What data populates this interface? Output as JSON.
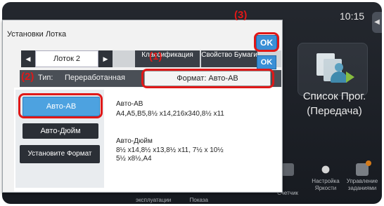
{
  "status": {
    "clock": "10:15"
  },
  "home": {
    "program_tile_line1": "Список Прог.",
    "program_tile_line2": "(Передача)",
    "bottom_items": [
      {
        "label": "Счетчик"
      },
      {
        "label": "Настройка Яркости"
      },
      {
        "label": "Управление заданиями"
      }
    ],
    "bottom_line2": [
      "эксплуатации",
      "Показа"
    ]
  },
  "dialog": {
    "title": "Установки Лотка",
    "ok_label": "OK",
    "tray_tab": "Лоток 2",
    "classification_tab": "Классификация",
    "property_tab": "Свойство Бумаги",
    "type_label": "Тип:",
    "type_value": "Переработанная",
    "format_box": "Формат:  Авто-AB",
    "buttons": {
      "auto_ab": "Авто-AB",
      "auto_inch": "Авто-Дюйм",
      "set_format": "Установите Формат"
    },
    "ab_heading": "Авто-AB",
    "ab_sizes": "A4,A5,B5,8½ x14,216x340,8½ x11",
    "inch_heading": "Авто-Дюйм",
    "inch_sizes_1": "8½ x14,8½ x13,8½ x11, 7½ x 10½",
    "inch_sizes_2": "5½ x8½,A4"
  },
  "callouts": [
    "(1)",
    "(2)",
    "(3)"
  ],
  "colors": {
    "accent": "#3a8fd6",
    "callout": "#e01818",
    "selected_button": "#4da2e0"
  }
}
